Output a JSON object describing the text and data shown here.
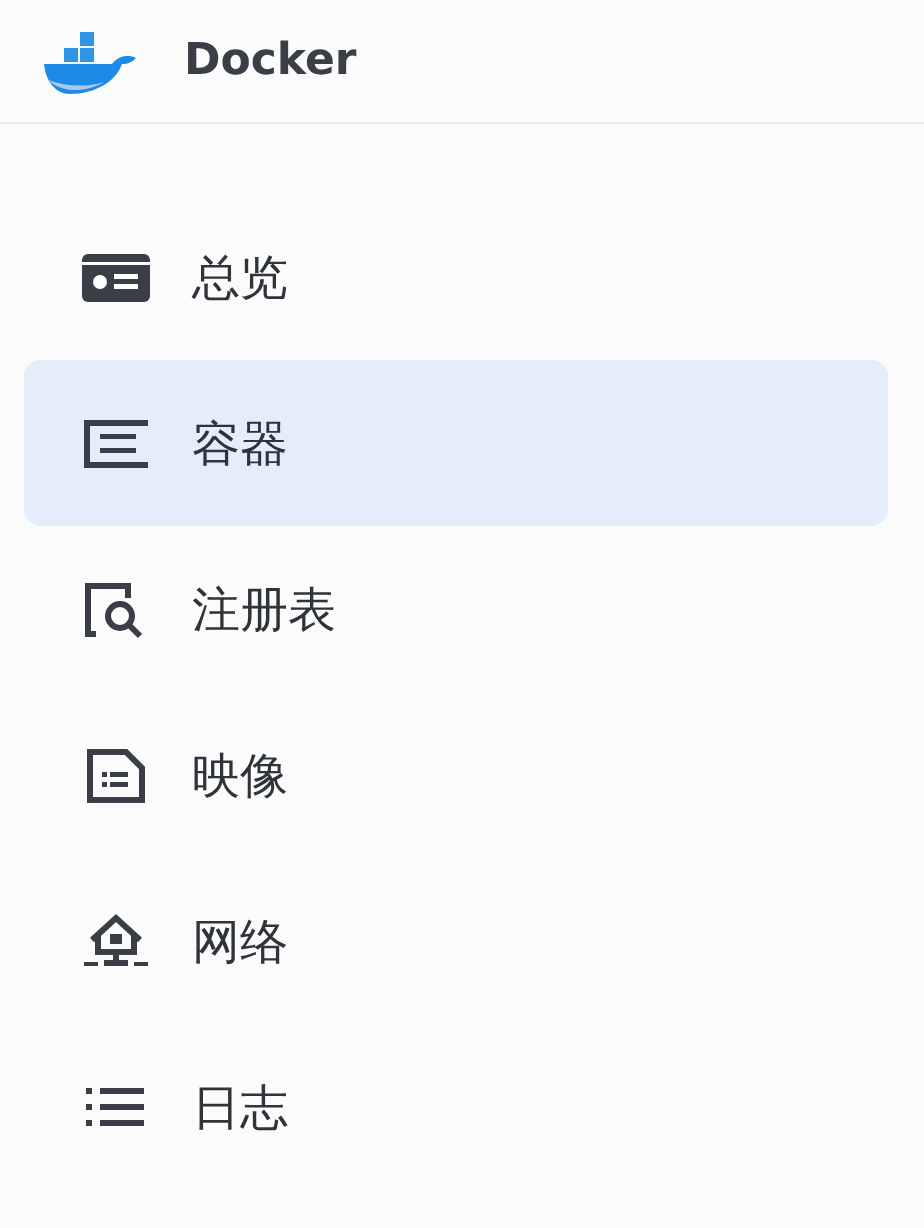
{
  "app": {
    "title": "Docker"
  },
  "nav": [
    {
      "label": "总览",
      "selected": false
    },
    {
      "label": "容器",
      "selected": true
    },
    {
      "label": "注册表",
      "selected": false
    },
    {
      "label": "映像",
      "selected": false
    },
    {
      "label": "网络",
      "selected": false
    },
    {
      "label": "日志",
      "selected": false
    }
  ]
}
